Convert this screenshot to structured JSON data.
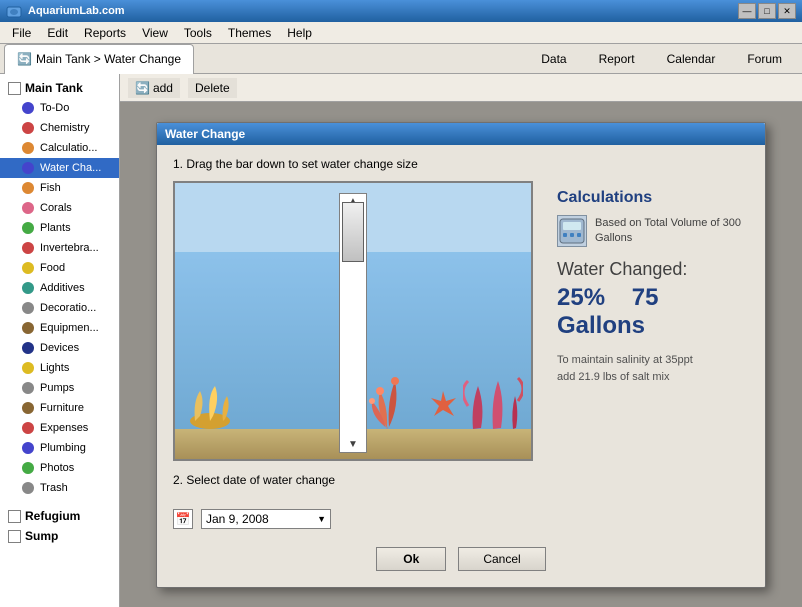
{
  "titleBar": {
    "title": "AquariumLab.com",
    "buttons": [
      "—",
      "□",
      "✕"
    ]
  },
  "menuBar": {
    "items": [
      "File",
      "Edit",
      "Reports",
      "View",
      "Tools",
      "Themes",
      "Help"
    ]
  },
  "tabs": {
    "active": "Main Tank > Water Change",
    "activeIcon": "🔄",
    "items": [
      {
        "label": "Main Tank > Water Change",
        "icon": "🔄"
      }
    ],
    "rightItems": [
      "Data",
      "Report",
      "Calendar",
      "Forum"
    ]
  },
  "toolbar": {
    "addLabel": "add",
    "deleteLabel": "Delete"
  },
  "sidebar": {
    "header": "Main Tank",
    "items": [
      {
        "label": "To-Do",
        "icon": "check",
        "color": "blue"
      },
      {
        "label": "Chemistry",
        "icon": "flask",
        "color": "red"
      },
      {
        "label": "Calculatio...",
        "icon": "calc",
        "color": "orange"
      },
      {
        "label": "Water Cha...",
        "icon": "water",
        "color": "blue",
        "selected": true
      },
      {
        "label": "Fish",
        "icon": "fish",
        "color": "orange"
      },
      {
        "label": "Corals",
        "icon": "coral",
        "color": "pink"
      },
      {
        "label": "Plants",
        "icon": "plant",
        "color": "green"
      },
      {
        "label": "Invertebra...",
        "icon": "invert",
        "color": "red"
      },
      {
        "label": "Food",
        "icon": "food",
        "color": "yellow"
      },
      {
        "label": "Additives",
        "icon": "additive",
        "color": "teal"
      },
      {
        "label": "Decoratio...",
        "icon": "deco",
        "color": "gray"
      },
      {
        "label": "Equipmen...",
        "icon": "equip",
        "color": "brown"
      },
      {
        "label": "Devices",
        "icon": "device",
        "color": "navy"
      },
      {
        "label": "Lights",
        "icon": "light",
        "color": "yellow"
      },
      {
        "label": "Pumps",
        "icon": "pump",
        "color": "gray"
      },
      {
        "label": "Furniture",
        "icon": "furn",
        "color": "brown"
      },
      {
        "label": "Expenses",
        "icon": "exp",
        "color": "red"
      },
      {
        "label": "Plumbing",
        "icon": "plumb",
        "color": "blue"
      },
      {
        "label": "Photos",
        "icon": "photo",
        "color": "green"
      },
      {
        "label": "Trash",
        "icon": "trash",
        "color": "gray"
      }
    ],
    "bottomItems": [
      {
        "label": "Refugium",
        "bold": true
      },
      {
        "label": "Sump",
        "bold": true
      }
    ]
  },
  "modal": {
    "title": "Water Change",
    "instruction1": "1. Drag the bar down to set water change size",
    "instruction2": "2. Select date of water change",
    "calculations": {
      "title": "Calculations",
      "description": "Based on Total Volume of 300 Gallons",
      "waterChangedLabel": "Water Changed:",
      "percent": "25%",
      "gallons": "75 Gallons",
      "saltNote": "To maintain salinity at 35ppt\nadd 21.9 lbs of salt mix"
    },
    "dateLabel": "Jan   9, 2008",
    "buttons": {
      "ok": "Ok",
      "cancel": "Cancel"
    }
  }
}
